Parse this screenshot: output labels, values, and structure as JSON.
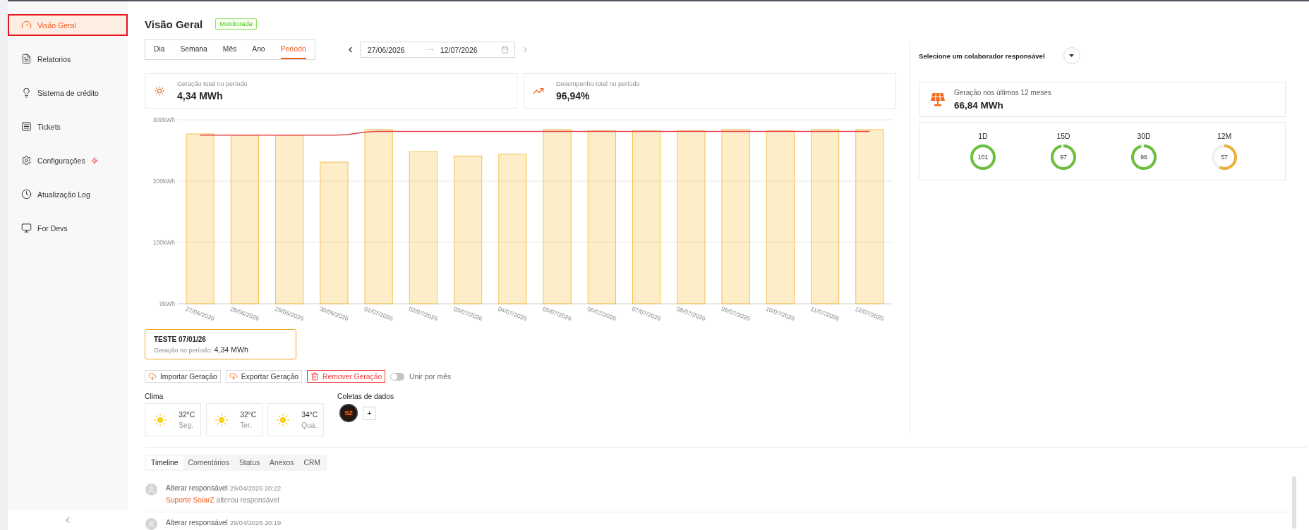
{
  "sidebar": {
    "items": [
      {
        "label": "Visão Geral",
        "selected": true,
        "badge": false
      },
      {
        "label": "Relatorios",
        "selected": false,
        "badge": false
      },
      {
        "label": "Sistema de crédito",
        "selected": false,
        "badge": false
      },
      {
        "label": "Tickets",
        "selected": false,
        "badge": false
      },
      {
        "label": "Configurações",
        "selected": false,
        "badge": true
      },
      {
        "label": "Atualização Log",
        "selected": false,
        "badge": false
      },
      {
        "label": "For Devs",
        "selected": false,
        "badge": false
      }
    ]
  },
  "header": {
    "title": "Visão Geral",
    "status": "Monitorada"
  },
  "period_tabs": [
    {
      "label": "Dia",
      "selected": false
    },
    {
      "label": "Semana",
      "selected": false
    },
    {
      "label": "Mês",
      "selected": false
    },
    {
      "label": "Ano",
      "selected": false
    },
    {
      "label": "Período",
      "selected": true
    }
  ],
  "date_range": {
    "start": "27/06/2026",
    "end": "12/07/2026",
    "prev_disabled": false,
    "next_disabled": true
  },
  "stats": [
    {
      "label": "Geração total no período",
      "value": "4,34 MWh"
    },
    {
      "label": "Desempenho total no período",
      "value": "96,94%"
    }
  ],
  "chart": {
    "chart_data": {
      "type": "bar",
      "categories": [
        "27/06/2026",
        "28/06/2026",
        "29/06/2026",
        "30/06/2026",
        "01/07/2026",
        "02/07/2026",
        "03/07/2026",
        "04/07/2026",
        "05/07/2026",
        "06/07/2026",
        "07/07/2026",
        "08/07/2026",
        "09/07/2026",
        "10/07/2026",
        "11/07/2026",
        "12/07/2026"
      ],
      "series": [
        {
          "type": "bar",
          "color": "#f7c24c",
          "values": [
            277,
            275,
            275,
            231,
            284,
            248,
            241,
            244,
            284,
            282,
            282,
            282,
            284,
            282,
            284,
            284
          ]
        },
        {
          "type": "line",
          "color": "#e5474f",
          "values": [
            275,
            275,
            275,
            275,
            281,
            281,
            281,
            281,
            281,
            281,
            281,
            281,
            281,
            281,
            281,
            281
          ]
        }
      ],
      "ylim": [
        0,
        300
      ],
      "yticks": [
        {
          "value": 0,
          "label": "0kWh"
        },
        {
          "value": 100,
          "label": "100kWh"
        },
        {
          "value": 200,
          "label": "200kWh"
        },
        {
          "value": 300,
          "label": "300kWh"
        }
      ]
    }
  },
  "plant_card": {
    "name": "TESTE 07/01/26",
    "label": "Geração no período:",
    "value": "4,34 MWh"
  },
  "actions": [
    {
      "label": "Importar Geração",
      "kind": "default"
    },
    {
      "label": "Exportar Geração",
      "kind": "default"
    },
    {
      "label": "Remover Geração",
      "kind": "danger"
    }
  ],
  "merge_toggle": {
    "label": "Unir por mês",
    "on": false
  },
  "weather": {
    "title": "Clima",
    "days": [
      {
        "temp": "32°C",
        "day": "Seg."
      },
      {
        "temp": "32°C",
        "day": "Ter."
      },
      {
        "temp": "34°C",
        "day": "Qua."
      }
    ]
  },
  "data_collection": {
    "title": "Coletas de dados",
    "sources": [
      {
        "initials": "SZ"
      }
    ],
    "add_label": "+"
  },
  "activity_tabs": [
    {
      "label": "Timeline",
      "selected": true
    },
    {
      "label": "Comentários",
      "selected": false
    },
    {
      "label": "Status",
      "selected": false
    },
    {
      "label": "Anexos",
      "selected": false
    },
    {
      "label": "CRM",
      "selected": false
    }
  ],
  "timeline": [
    {
      "action": "Alterar responsável",
      "time": "29/04/2026 20:22",
      "actor": "Suporte SolarZ",
      "detail": "alterou responsável"
    },
    {
      "action": "Alterar responsável",
      "time": "29/04/2026 20:19"
    }
  ],
  "responsible": {
    "label": "Selecione um colaborador responsável"
  },
  "generation_12m": {
    "label": "Geração nos últimos 12 meses",
    "value": "66,84 MWh"
  },
  "performance": [
    {
      "period": "1D",
      "value": "101",
      "level": 1,
      "color": "#6cbf3f"
    },
    {
      "period": "15D",
      "value": "97",
      "level": 0.97,
      "color": "#6cbf3f"
    },
    {
      "period": "30D",
      "value": "96",
      "level": 0.96,
      "color": "#6cbf3f"
    },
    {
      "period": "12M",
      "value": "57",
      "level": 0.57,
      "color": "#e9b13c"
    }
  ]
}
